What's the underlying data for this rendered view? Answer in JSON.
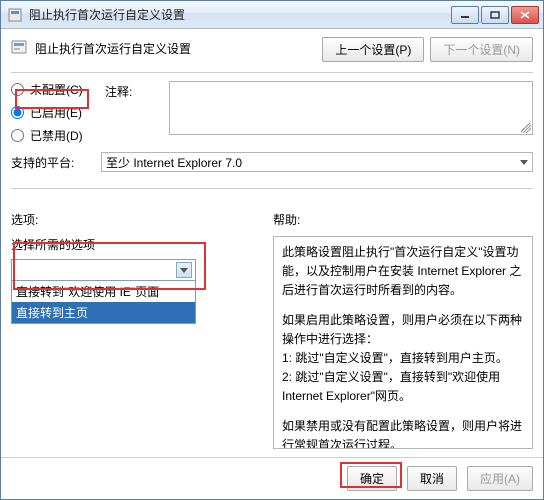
{
  "window": {
    "title": "阻止执行首次运行自定义设置"
  },
  "header": {
    "title": "阻止执行首次运行自定义设置",
    "prev_btn": "上一个设置(P)",
    "next_btn": "下一个设置(N)"
  },
  "radios": {
    "not_configured": "未配置(C)",
    "enabled": "已启用(E)",
    "disabled": "已禁用(D)"
  },
  "labels": {
    "comment": "注释:",
    "platform": "支持的平台:",
    "options": "选项:",
    "help": "帮助:"
  },
  "platform": {
    "value": "至少 Internet Explorer 7.0"
  },
  "options": {
    "prompt": "选择所需的选项",
    "combo_value": "",
    "items": [
      "直接转到\"欢迎使用 IE\"页面",
      "直接转到主页"
    ]
  },
  "help": {
    "p1": "此策略设置阻止执行\"首次运行自定义\"设置功能，以及控制用户在安装 Internet Explorer 之后进行首次运行时所看到的内容。",
    "p2": "如果启用此策略设置，则用户必须在以下两种操作中进行选择：",
    "p2a": "1: 跳过\"自定义设置\"，直接转到用户主页。",
    "p2b": "2: 跳过\"自定义设置\"，直接转到\"欢迎使用 Internet Explorer\"网页。",
    "p3": "如果禁用或没有配置此策略设置，则用户将进行常规首次运行过程。"
  },
  "footer": {
    "ok": "确定",
    "cancel": "取消",
    "apply": "应用(A)"
  }
}
